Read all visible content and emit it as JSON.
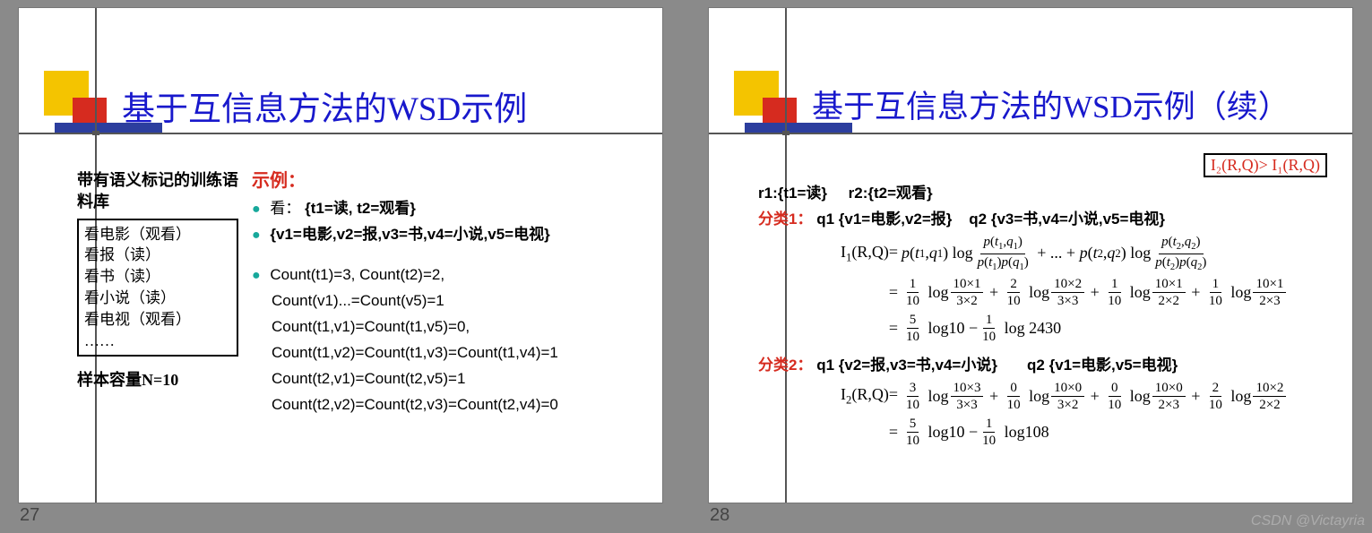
{
  "watermark": "CSDN @Victayria",
  "slide27": {
    "page": "27",
    "title": "基于互信息方法的WSD示例",
    "left_label": "带有语义标记的训练语料库",
    "corpus": [
      "看电影（观看）",
      "看报（读）",
      "看书（读）",
      "看小说（读）",
      "看电视（观看）",
      "……"
    ],
    "sample_label": "样本容量N=10",
    "example_label": "示例：",
    "bul1_prefix": "看：",
    "bul1_rest": "{t1=读, t2=观看}",
    "bul2": "{v1=电影,v2=报,v3=书,v4=小说,v5=电视}",
    "counts": [
      "Count(t1)=3, Count(t2)=2,",
      "Count(v1)...=Count(v5)=1",
      "Count(t1,v1)=Count(t1,v5)=0,",
      "Count(t1,v2)=Count(t1,v3)=Count(t1,v4)=1",
      "Count(t2,v1)=Count(t2,v5)=1",
      "Count(t2,v2)=Count(t2,v3)=Count(t2,v4)=0"
    ]
  },
  "slide28": {
    "page": "28",
    "title": "基于互信息方法的WSD示例（续）",
    "highlight": "I₂(R,Q)> I₁(R,Q)",
    "r_row": "r1:{t1=读}     r2:{t2=观看}",
    "class1_label": "分类1：",
    "class1_body": "q1 {v1=电影,v2=报}    q2 {v3=书,v4=小说,v5=电视}",
    "class2_label": "分类2：",
    "class2_body": "q1 {v2=报,v3=书,v4=小说}       q2 {v1=电影,v5=电视}",
    "eq1_lhs": "I₁(R,Q)=",
    "eq1_general": "p(t₁,q₁) log (p(t₁,q₁)/(p(t₁)p(q₁))) + ... + p(t₂,q₂) log (p(t₂,q₂)/(p(t₂)p(q₂)))",
    "eq1_terms": [
      {
        "coef": "1/10",
        "top": "10×1",
        "bot": "3×2"
      },
      {
        "coef": "2/10",
        "top": "10×2",
        "bot": "3×3"
      },
      {
        "coef": "1/10",
        "top": "10×1",
        "bot": "2×2"
      },
      {
        "coef": "1/10",
        "top": "10×1",
        "bot": "2×3"
      }
    ],
    "eq1_result": "= (5/10) log 10 − (1/10) log 2430",
    "eq2_lhs": "I₂(R,Q)=",
    "eq2_terms": [
      {
        "coef": "3/10",
        "top": "10×3",
        "bot": "3×3"
      },
      {
        "coef": "0/10",
        "top": "10×0",
        "bot": "3×2"
      },
      {
        "coef": "0/10",
        "top": "10×0",
        "bot": "2×3"
      },
      {
        "coef": "2/10",
        "top": "10×2",
        "bot": "2×2"
      }
    ],
    "eq2_result": "= (5/10) log 10 − (1/10) log 108"
  }
}
